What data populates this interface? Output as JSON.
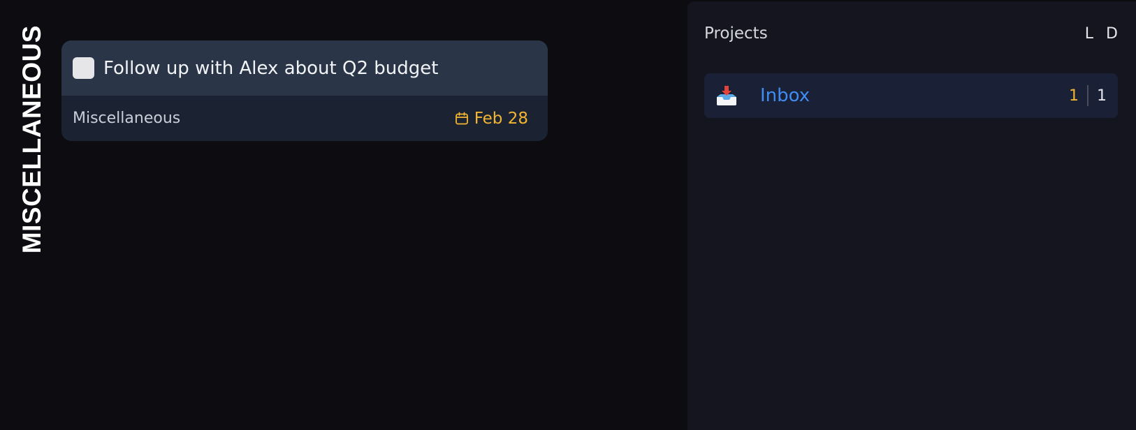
{
  "section": {
    "label": "MISCELLANEOUS"
  },
  "task": {
    "title": "Follow up with Alex about Q2 budget",
    "project": "Miscellaneous",
    "due": "Feb 28",
    "due_icon": "calendar-icon"
  },
  "sidebar": {
    "title": "Projects",
    "toggles": [
      "L",
      "D"
    ],
    "projects": [
      {
        "icon": "inbox-tray-icon",
        "name": "Inbox",
        "due_count": "1",
        "total_count": "1"
      }
    ]
  },
  "colors": {
    "accent_blue": "#3f8cf2",
    "due_yellow": "#f2b531",
    "background": "#0c0c11",
    "sidebar_bg": "#15151f",
    "card_head": "#2a3648",
    "card_body": "#1b2332"
  }
}
